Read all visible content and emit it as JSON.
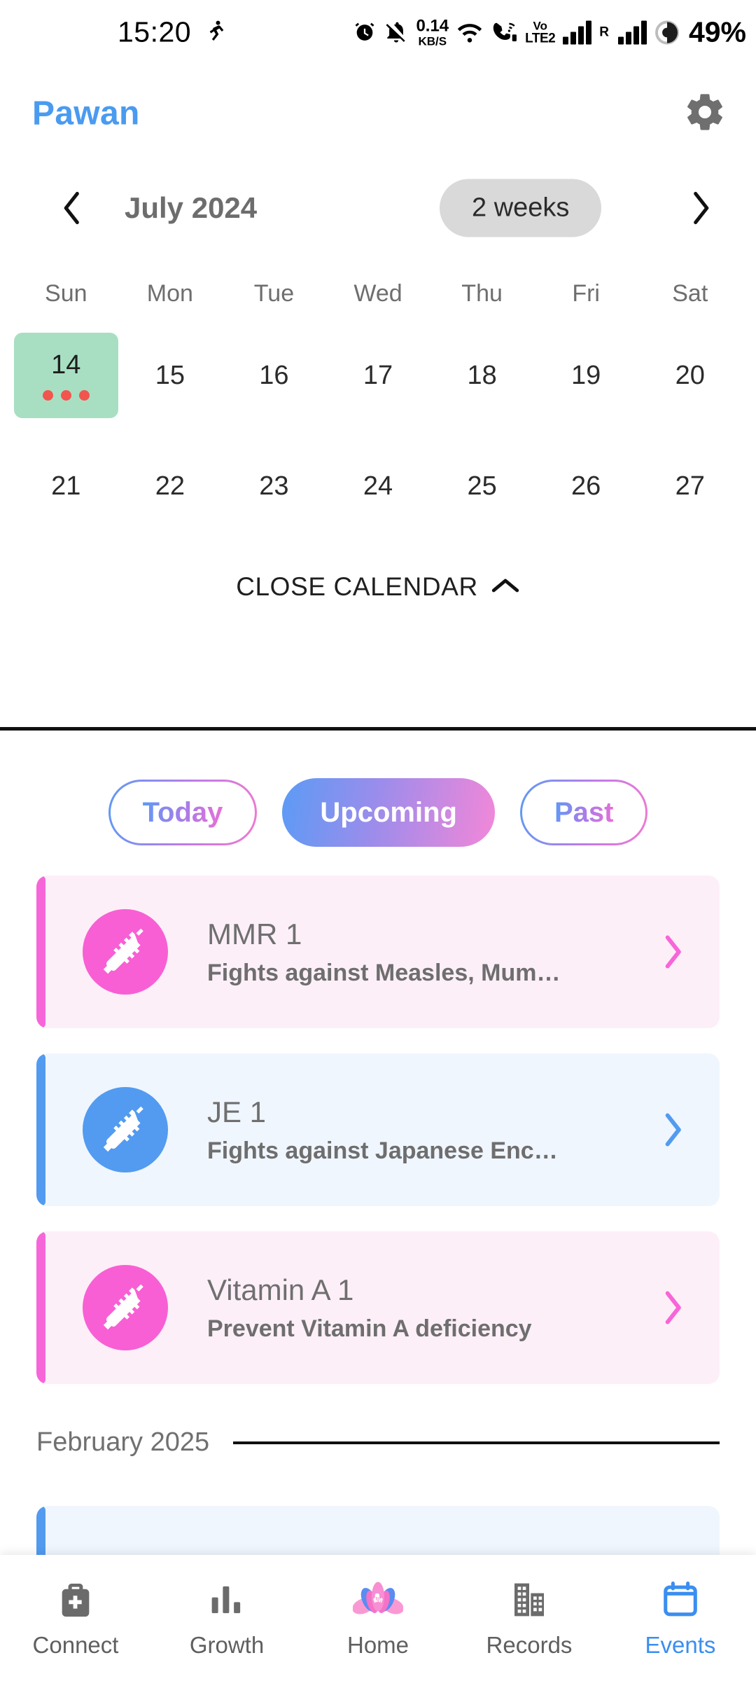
{
  "status_bar": {
    "time": "15:20",
    "activity_icon": "running-person-icon",
    "icons": [
      "alarm-icon",
      "notifications-muted-icon",
      "network-speed",
      "wifi-icon",
      "call-wifi-icon",
      "volte-icon",
      "signal-bars-sim1",
      "signal-bars-sim2-roaming",
      "battery-saver-icon"
    ],
    "net_speed_value": "0.14",
    "net_speed_unit": "KB/S",
    "volte_top": "Vo",
    "volte_bottom": "LTE2",
    "roaming_label": "R",
    "battery": "49%"
  },
  "app_bar": {
    "title": "Pawan",
    "settings_icon": "gear-icon",
    "title_color": "#4a9bf0"
  },
  "calendar": {
    "prev_icon": "chevron-left-icon",
    "next_icon": "chevron-right-icon",
    "month_label": "July 2024",
    "range_label": "2 weeks",
    "day_names": [
      "Sun",
      "Mon",
      "Tue",
      "Wed",
      "Thu",
      "Fri",
      "Sat"
    ],
    "weeks": [
      [
        {
          "day": "14",
          "selected": true,
          "dots": 3
        },
        {
          "day": "15",
          "selected": false,
          "dots": 0
        },
        {
          "day": "16",
          "selected": false,
          "dots": 0
        },
        {
          "day": "17",
          "selected": false,
          "dots": 0
        },
        {
          "day": "18",
          "selected": false,
          "dots": 0
        },
        {
          "day": "19",
          "selected": false,
          "dots": 0
        },
        {
          "day": "20",
          "selected": false,
          "dots": 0
        }
      ],
      [
        {
          "day": "21",
          "selected": false,
          "dots": 0
        },
        {
          "day": "22",
          "selected": false,
          "dots": 0
        },
        {
          "day": "23",
          "selected": false,
          "dots": 0
        },
        {
          "day": "24",
          "selected": false,
          "dots": 0
        },
        {
          "day": "25",
          "selected": false,
          "dots": 0
        },
        {
          "day": "26",
          "selected": false,
          "dots": 0
        },
        {
          "day": "27",
          "selected": false,
          "dots": 0
        }
      ]
    ],
    "close_label": "CLOSE CALENDAR",
    "close_icon": "chevron-up-icon",
    "selected_bg": "#a8dfc3",
    "dot_color": "#f2554d"
  },
  "filters": {
    "today": "Today",
    "upcoming": "Upcoming",
    "past": "Past",
    "active": "Upcoming",
    "gradient_start": "#5b9bf5",
    "gradient_end": "#f387d8"
  },
  "events": [
    {
      "title": "MMR 1",
      "subtitle": "Fights against Measles, Mum…",
      "theme": "pink",
      "icon": "syringe-icon",
      "chevron": "chevron-right-icon",
      "accent": "#f766d8"
    },
    {
      "title": "JE 1",
      "subtitle": "Fights against Japanese Enc…",
      "theme": "blue",
      "icon": "syringe-icon",
      "chevron": "chevron-right-icon",
      "accent": "#529bf0"
    },
    {
      "title": "Vitamin A 1",
      "subtitle": "Prevent Vitamin A deficiency",
      "theme": "pink",
      "icon": "syringe-icon",
      "chevron": "chevron-right-icon",
      "accent": "#f766d8"
    }
  ],
  "month_section": {
    "label": "February 2025"
  },
  "bottom_nav": {
    "items": [
      {
        "label": "Connect",
        "icon": "medical-bag-icon",
        "active": false
      },
      {
        "label": "Growth",
        "icon": "bar-chart-icon",
        "active": false
      },
      {
        "label": "Home",
        "icon": "lotus-logo-icon",
        "active": false
      },
      {
        "label": "Records",
        "icon": "building-icon",
        "active": false
      },
      {
        "label": "Events",
        "icon": "calendar-icon",
        "active": true
      }
    ],
    "active_color": "#3b8ef0"
  }
}
